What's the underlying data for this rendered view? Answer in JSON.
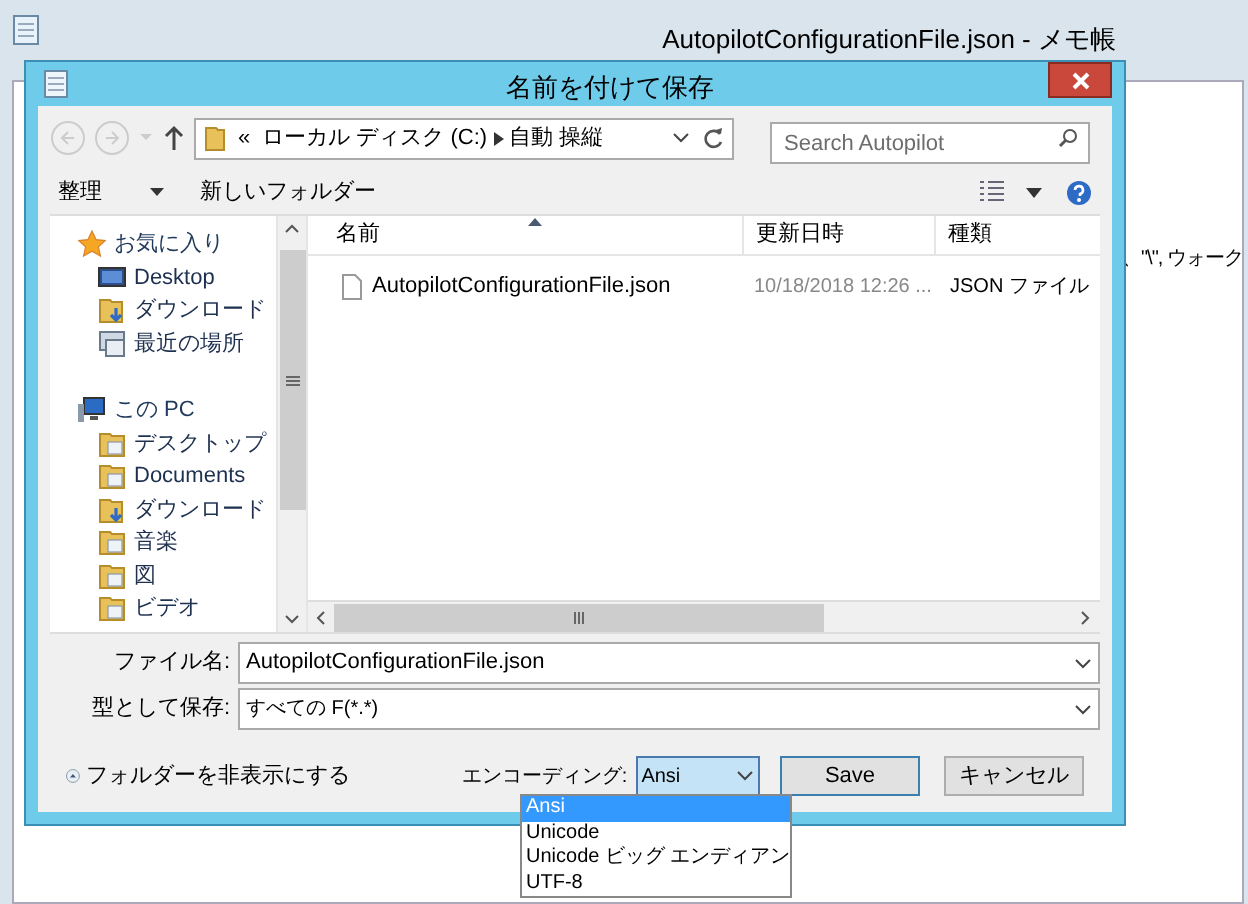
{
  "notepad": {
    "title": "AutopilotConfigurationFile.json - メモ帳",
    "text": "、\"\\\", ウォーク"
  },
  "dialog": {
    "title": "名前を付けて保存",
    "address": {
      "overflow": "«",
      "crumbs": [
        "ローカル ディスク (C:)",
        "自動 操縦"
      ]
    },
    "search": {
      "placeholder": "Search Autopilot"
    },
    "toolbar": {
      "organize": "整理",
      "new_folder": "新しいフォルダー"
    },
    "sidebar": [
      {
        "label": "お気に入り",
        "kind": "star",
        "children": [
          {
            "label": "Desktop",
            "kind": "desktop"
          },
          {
            "label": "ダウンロード",
            "kind": "download"
          },
          {
            "label": "最近の場所",
            "kind": "recent"
          }
        ]
      },
      {
        "label": "この PC",
        "kind": "pc",
        "children": [
          {
            "label": "デスクトップ",
            "kind": "folder"
          },
          {
            "label": "Documents",
            "kind": "folder"
          },
          {
            "label": "ダウンロード",
            "kind": "download"
          },
          {
            "label": "音楽",
            "kind": "folder"
          },
          {
            "label": "図",
            "kind": "folder"
          },
          {
            "label": "ビデオ",
            "kind": "folder"
          }
        ]
      }
    ],
    "columns": [
      "名前",
      "更新日時",
      "種類"
    ],
    "files": [
      {
        "name": "AutopilotConfigurationFile.json",
        "modified": "10/18/2018 12:26 ...",
        "type": "JSON ファイル"
      }
    ],
    "file_name": {
      "label": "ファイル名:",
      "value": "AutopilotConfigurationFile.json"
    },
    "file_type": {
      "label": "型として保存:",
      "value": "すべての F(*.*)"
    },
    "hide_folders": "フォルダーを非表示にする",
    "encoding": {
      "label": "エンコーディング:",
      "value": "Ansi",
      "options": [
        {
          "label": "Ansi",
          "selected": true
        },
        {
          "label": "Unicode",
          "selected": false
        },
        {
          "label": "Unicode ビッグ エンディアン",
          "selected": false
        },
        {
          "label": "UTF-8",
          "selected": false
        }
      ]
    },
    "buttons": [
      "Save",
      "キャンセル"
    ]
  }
}
